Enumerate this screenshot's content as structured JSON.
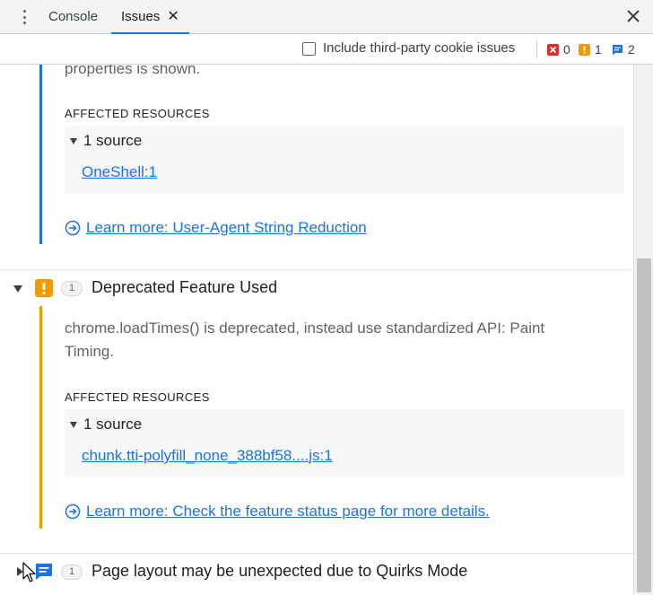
{
  "tabs": {
    "console_label": "Console",
    "issues_label": "Issues",
    "issues_close": "✕"
  },
  "toolbar": {
    "third_party_label": "Include third-party cookie issues",
    "third_party_checked": false,
    "errors_count": "0",
    "warnings_count": "1",
    "info_count": "2"
  },
  "issue_user_agent": {
    "body_tail": "properties is shown.",
    "affected_title": "AFFECTED RESOURCES",
    "source_toggle": "1 source",
    "source_link": "OneShell:1",
    "learn_more": "Learn more: User-Agent String Reduction",
    "accent_color": "#1a73e8"
  },
  "issue_deprecated": {
    "count": "1",
    "title": "Deprecated Feature Used",
    "body_line1": "chrome.loadTimes() is deprecated, instead use standardized API: Paint",
    "body_line2": "Timing.",
    "affected_title": "AFFECTED RESOURCES",
    "source_toggle": "1 source",
    "source_link": "chunk.tti-polyfill_none_388bf58....js:1",
    "learn_more": "Learn more: Check the feature status page for more details.",
    "accent_color": "#f29900"
  },
  "issue_quirks": {
    "count": "1",
    "title": "Page layout may be unexpected due to Quirks Mode",
    "accent_color": "#1a73e8"
  },
  "icons": {
    "menu": "kebab-menu-icon",
    "close": "close-icon",
    "error": "error-icon",
    "warning": "warning-icon",
    "info": "info-icon",
    "learn_more": "arrow-circle-right-icon"
  }
}
